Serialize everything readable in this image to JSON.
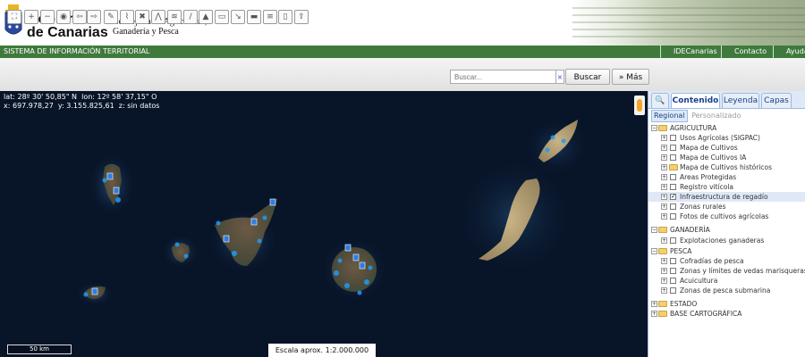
{
  "header": {
    "logo_line1": "Gobierno",
    "logo_line2": "de Canarias",
    "department": "Consejería de Agricultura,\nGanadería y Pesca"
  },
  "greenbar": {
    "system_name": "SISTEMA DE INFORMACIÓN TERRITORIAL",
    "nav": [
      "IDECanarias",
      "Contacto",
      "Ayuda"
    ]
  },
  "toolbar": {
    "tools": [
      "zoom-extent-icon",
      "zoom-in-icon",
      "zoom-out-icon",
      "globe-icon",
      "back-icon",
      "forward-icon",
      "measure-distance-icon",
      "measure-area-icon",
      "identify-icon",
      "select-icon",
      "layers-icon",
      "draw-line-icon",
      "profile-icon",
      "draw-polygon-icon",
      "export-icon",
      "print-icon",
      "stack-icon",
      "columns-icon",
      "share-icon"
    ],
    "search_placeholder": "Buscar...",
    "search_clear": "×",
    "search_button": "Buscar",
    "more_button": "» Más"
  },
  "map": {
    "coord_line1": "lat: 28º 30' 50,85\" N  lon: 12º 58' 37,15\" O",
    "coord_line2": "x: 697.978,27  y: 3.155.825,61  z: sin datos",
    "scale_bar": "50 km",
    "scale_text": "Escala aprox. 1:2.000.000"
  },
  "panel": {
    "search_tab": "🔍",
    "tabs": [
      "Contenido",
      "Leyenda",
      "Capas"
    ],
    "subtabs": [
      "Regional",
      "Personalizado"
    ],
    "tree": {
      "agricultura": "AGRICULTURA",
      "agri_items": [
        "Usos Agrícolas (SIGPAC)",
        "Mapa de Cultivos",
        "Mapa de Cultivos IA",
        "Mapa de Cultivos históricos",
        "Areas Protegidas",
        "Registro vitícola",
        "Infraestructura de regadío",
        "Zonas rurales",
        "Fotos de cultivos agrícolas"
      ],
      "ganaderia": "GANADERÍA",
      "gan_items": [
        "Explotaciones ganaderas"
      ],
      "pesca": "PESCA",
      "pesca_items": [
        "Cofradías de pesca",
        "Zonas y límites de vedas marisqueras a pie",
        "Acuicultura",
        "Zonas de pesca submarina"
      ],
      "estado": "ESTADO",
      "base": "BASE CARTOGRÁFICA"
    }
  },
  "colors": {
    "green_bar": "#3f7a3c",
    "ocean": "#081428",
    "panel_tab": "#15428b",
    "folder": "#f3d06a"
  }
}
